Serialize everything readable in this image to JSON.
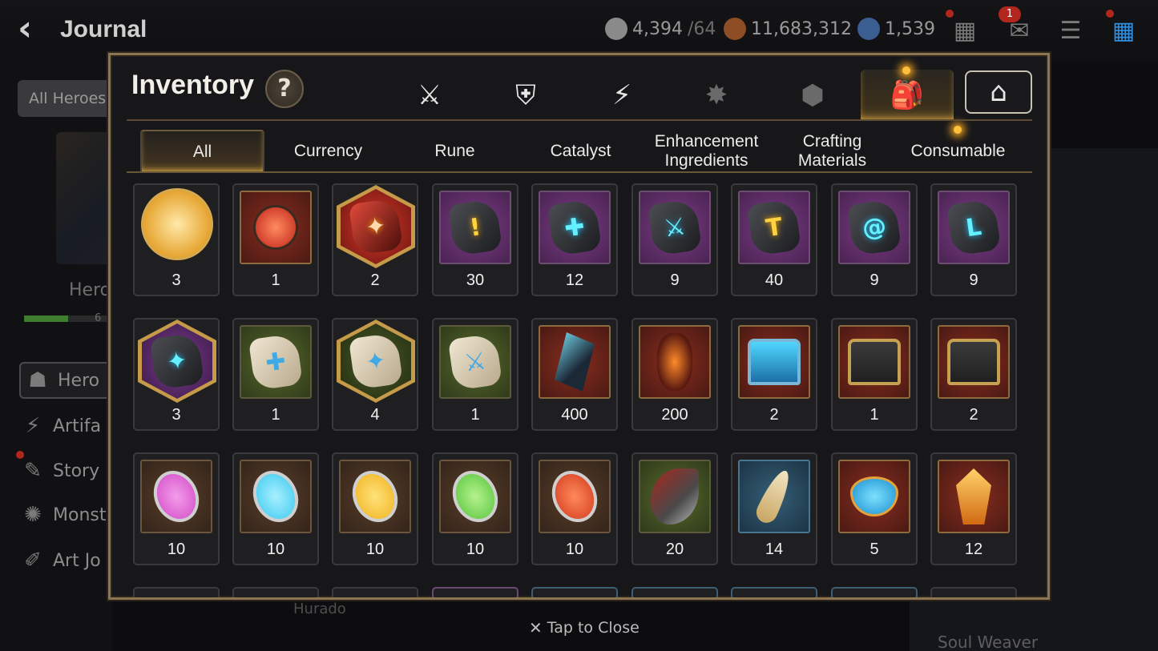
{
  "header": {
    "title": "Journal",
    "currencies": [
      {
        "icon": "stamina-icon",
        "value": "4,394",
        "max": "/64",
        "color": "#bfbfbf"
      },
      {
        "icon": "gold-icon",
        "value": "11,683,312",
        "color": "#b56a36"
      },
      {
        "icon": "skystone-icon",
        "value": "1,539",
        "color": "#4a76b5"
      }
    ],
    "mail_badge": "1"
  },
  "background": {
    "filter_label": "All Heroes",
    "hero_label": "Hero",
    "hero_progress_label": "6",
    "hero_progress": 0.5,
    "nav": [
      "Hero",
      "Artifa",
      "Story",
      "Monst",
      "Art Jo"
    ],
    "hurado": "Hurado",
    "soul_weaver": "Soul Weaver"
  },
  "modal": {
    "title": "Inventory",
    "help": "?",
    "category_tabs": [
      {
        "icon": "hero-equipment-icon",
        "glyph": "⚔"
      },
      {
        "icon": "no-weapon-icon",
        "glyph": "⛨"
      },
      {
        "icon": "lightning-icon",
        "glyph": "⚡"
      },
      {
        "icon": "explosion-icon",
        "glyph": "✸"
      },
      {
        "icon": "cube-icon",
        "glyph": "⬢"
      },
      {
        "icon": "backpack-icon",
        "glyph": "🎒"
      },
      {
        "icon": "storage-icon",
        "glyph": "⌂"
      }
    ],
    "sub_tabs": [
      "All",
      "Currency",
      "Rune",
      "Catalyst",
      "Enhancement Ingredients",
      "Crafting Materials",
      "Consumable"
    ],
    "active_sub_tab": "All",
    "items": [
      {
        "kind": "bird-round",
        "count": "3"
      },
      {
        "kind": "potion",
        "count": "1"
      },
      {
        "kind": "red-hex-crystal",
        "count": "2"
      },
      {
        "kind": "rune-purple-yellow",
        "count": "30",
        "glyph": "!"
      },
      {
        "kind": "rune-purple-cyan",
        "count": "12",
        "glyph": "✚"
      },
      {
        "kind": "rune-purple-cyan-sword",
        "count": "9",
        "glyph": "⚔"
      },
      {
        "kind": "rune-purple-yellow-hammer",
        "count": "40",
        "glyph": "T"
      },
      {
        "kind": "rune-purple-cyan-spiral",
        "count": "9",
        "glyph": "@"
      },
      {
        "kind": "rune-purple-cyan-boot",
        "count": "9",
        "glyph": "L"
      },
      {
        "kind": "rune-hex-purple",
        "count": "3",
        "glyph": "✦"
      },
      {
        "kind": "rune-green-light",
        "count": "1",
        "glyph": "✚"
      },
      {
        "kind": "rune-hex-green",
        "count": "4",
        "glyph": "✦"
      },
      {
        "kind": "rune-green-light-sword",
        "count": "1",
        "glyph": "⚔"
      },
      {
        "kind": "dark-shard",
        "count": "400"
      },
      {
        "kind": "red-shard",
        "count": "200"
      },
      {
        "kind": "blue-chest",
        "count": "2"
      },
      {
        "kind": "chest",
        "count": "1"
      },
      {
        "kind": "chest",
        "count": "2"
      },
      {
        "kind": "gem-pink",
        "count": "10",
        "color": "#d24ac8"
      },
      {
        "kind": "gem-cyan",
        "count": "10",
        "color": "#3ac9ef"
      },
      {
        "kind": "gem-yellow",
        "count": "10",
        "color": "#f0b21e"
      },
      {
        "kind": "gem-green",
        "count": "10",
        "color": "#56c43c"
      },
      {
        "kind": "gem-red",
        "count": "10",
        "color": "#d23a1e"
      },
      {
        "kind": "claw",
        "count": "20"
      },
      {
        "kind": "feather",
        "count": "14"
      },
      {
        "kind": "amulet",
        "count": "5"
      },
      {
        "kind": "crystal",
        "count": "12"
      }
    ]
  },
  "close_hint": "Tap to Close"
}
